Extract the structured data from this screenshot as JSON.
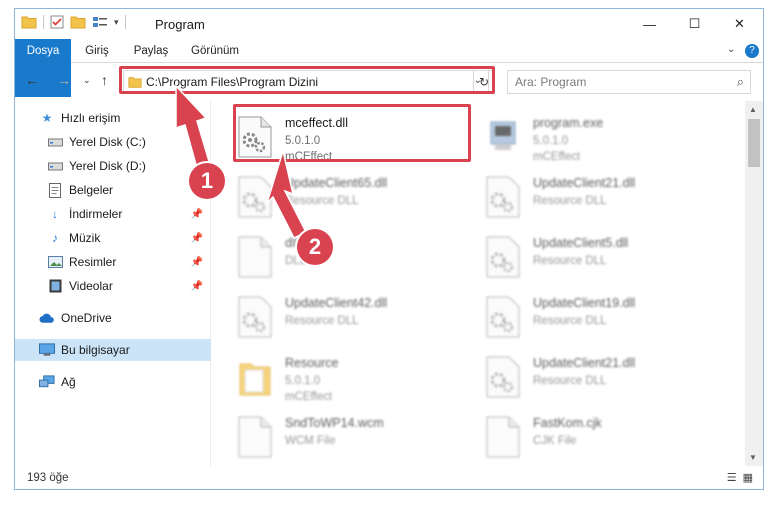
{
  "window": {
    "title": "Program",
    "controls": {
      "minimize": "—",
      "maximize": "☐",
      "close": "✕"
    }
  },
  "ribbon": {
    "tabs": [
      "Dosya",
      "Giriş",
      "Paylaş",
      "Görünüm"
    ]
  },
  "address": {
    "path": "C:\\Program Files\\Program Dizini",
    "search_placeholder": "Ara: Program"
  },
  "sidebar": {
    "items": [
      {
        "label": "Hızlı erişim",
        "icon": "star-icon",
        "pinned": false
      },
      {
        "label": "Yerel Disk (C:)",
        "icon": "drive-icon",
        "pinned": true
      },
      {
        "label": "Yerel Disk (D:)",
        "icon": "drive-icon",
        "pinned": false
      },
      {
        "label": "Belgeler",
        "icon": "document-icon",
        "pinned": false
      },
      {
        "label": "İndirmeler",
        "icon": "download-icon",
        "pinned": true
      },
      {
        "label": "Müzik",
        "icon": "music-icon",
        "pinned": true
      },
      {
        "label": "Resimler",
        "icon": "pictures-icon",
        "pinned": true
      },
      {
        "label": "Videolar",
        "icon": "video-icon",
        "pinned": true
      },
      {
        "label": "OneDrive",
        "icon": "cloud-icon",
        "pinned": false
      },
      {
        "label": "Bu bilgisayar",
        "icon": "computer-icon",
        "pinned": false,
        "selected": true
      },
      {
        "label": "Ağ",
        "icon": "network-icon",
        "pinned": false
      }
    ]
  },
  "files": [
    {
      "name": "mceffect.dll",
      "line1": "5.0.1.0",
      "line2": "mCEffect",
      "highlighted": true,
      "icon": "dll-gear-icon"
    },
    {
      "name": "program.exe",
      "line1": "5.0.1.0",
      "line2": "mCEffect",
      "icon": "exe-icon"
    },
    {
      "name": "UpdateClient65.dll",
      "line1": "Resource DLL",
      "line2": "",
      "icon": "dll-gear-icon"
    },
    {
      "name": "UpdateClient21.dll",
      "line1": "Resource DLL",
      "line2": "",
      "icon": "dll-gear-icon"
    },
    {
      "name": "dll",
      "line1": "DLL",
      "line2": "",
      "icon": "file-icon"
    },
    {
      "name": "UpdateClient5.dll",
      "line1": "Resource DLL",
      "line2": "",
      "icon": "dll-gear-icon"
    },
    {
      "name": "UpdateClient42.dll",
      "line1": "Resource DLL",
      "line2": "",
      "icon": "dll-gear-icon"
    },
    {
      "name": "UpdateClient19.dll",
      "line1": "Resource DLL",
      "line2": "",
      "icon": "dll-gear-icon"
    },
    {
      "name": "Resource",
      "line1": "5.0.1.0",
      "line2": "mCEffect",
      "icon": "folder-icon"
    },
    {
      "name": "UpdateClient21.dll",
      "line1": "Resource DLL",
      "line2": "",
      "icon": "dll-gear-icon"
    },
    {
      "name": "SndToWP14.wcm",
      "line1": "WCM File",
      "line2": "",
      "icon": "file-icon"
    },
    {
      "name": "FastKom.cjk",
      "line1": "CJK File",
      "line2": "",
      "icon": "file-icon"
    }
  ],
  "status": {
    "count": "193 öğe"
  },
  "annotations": {
    "step1": "1",
    "step2": "2"
  },
  "colors": {
    "accent": "#1979ca",
    "annotation_red": "#d94350",
    "selected_bg": "#cce4f7"
  }
}
